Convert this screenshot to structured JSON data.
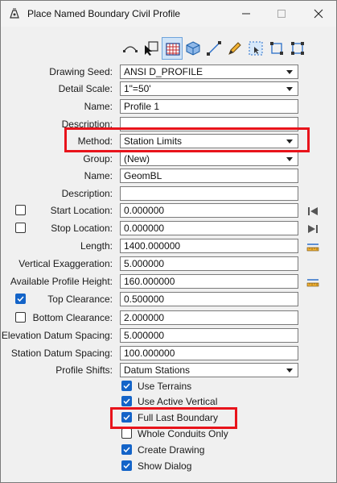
{
  "window": {
    "title": "Place Named Boundary Civil Profile",
    "icon": "pen-tool-icon"
  },
  "toolbar": {
    "tools": [
      {
        "icon": "curve-profile-icon",
        "active": false
      },
      {
        "icon": "select-element-icon",
        "active": false
      },
      {
        "icon": "grid-table-icon",
        "active": true
      },
      {
        "icon": "cube-3d-icon",
        "active": false
      },
      {
        "icon": "line-icon",
        "active": false
      },
      {
        "icon": "pencil-icon",
        "active": false
      },
      {
        "icon": "dashed-selection-icon",
        "active": false
      },
      {
        "icon": "rectangle-icon",
        "active": false
      },
      {
        "icon": "shape-vertices-icon",
        "active": false
      }
    ]
  },
  "form": {
    "drawing_seed": {
      "label": "Drawing Seed:",
      "value": "ANSI D_PROFILE"
    },
    "detail_scale": {
      "label": "Detail Scale:",
      "value": "1\"=50'"
    },
    "name": {
      "label": "Name:",
      "value": "Profile 1"
    },
    "description": {
      "label": "Description:",
      "value": ""
    },
    "method": {
      "label": "Method:",
      "value": "Station Limits"
    },
    "group": {
      "label": "Group:",
      "value": "(New)"
    },
    "group_name": {
      "label": "Name:",
      "value": "GeomBL"
    },
    "group_description": {
      "label": "Description:",
      "value": ""
    },
    "start_location": {
      "label": "Start Location:",
      "value": "0.000000",
      "checked": false
    },
    "stop_location": {
      "label": "Stop Location:",
      "value": "0.000000",
      "checked": false
    },
    "length": {
      "label": "Length:",
      "value": "1400.000000"
    },
    "vertical_exaggeration": {
      "label": "Vertical Exaggeration:",
      "value": "5.000000"
    },
    "available_profile_height": {
      "label": "Available Profile Height:",
      "value": "160.000000"
    },
    "top_clearance": {
      "label": "Top Clearance:",
      "value": "0.500000",
      "checked": true
    },
    "bottom_clearance": {
      "label": "Bottom Clearance:",
      "value": "2.000000",
      "checked": false
    },
    "elevation_datum_spacing": {
      "label": "Elevation Datum Spacing:",
      "value": "5.000000"
    },
    "station_datum_spacing": {
      "label": "Station Datum Spacing:",
      "value": "100.000000"
    },
    "profile_shifts": {
      "label": "Profile Shifts:",
      "value": "Datum Stations"
    }
  },
  "options": [
    {
      "label": "Use Terrains",
      "checked": true
    },
    {
      "label": "Use Active Vertical",
      "checked": true
    },
    {
      "label": "Full Last Boundary",
      "checked": true
    },
    {
      "label": "Whole Conduits Only",
      "checked": false
    },
    {
      "label": "Create Drawing",
      "checked": true
    },
    {
      "label": "Show Dialog",
      "checked": true
    }
  ],
  "colors": {
    "highlight": "#e8131b",
    "checkbox_on": "#1464c8",
    "tool_active": "#cfe3f7"
  }
}
